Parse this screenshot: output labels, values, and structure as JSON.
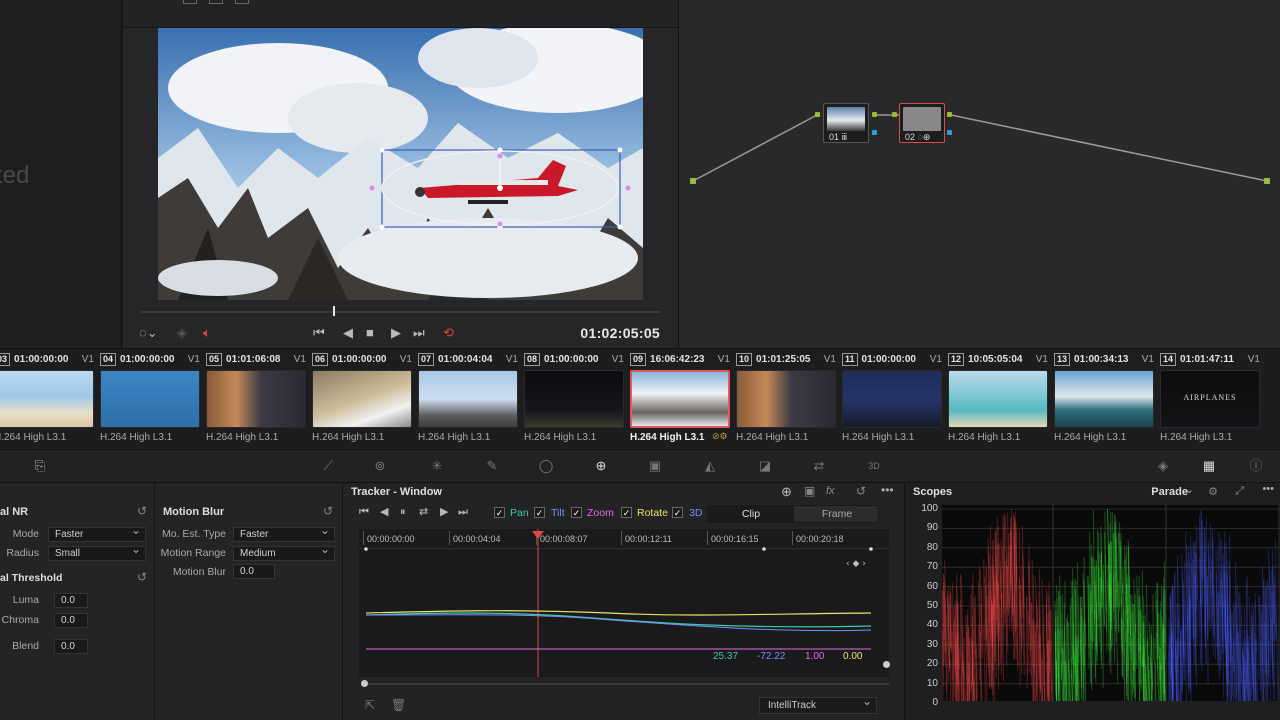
{
  "left_panel": {
    "ghost_text": "ted"
  },
  "viewer": {
    "timecode": "01:02:05:05",
    "playhead_fraction": 0.37
  },
  "nodes": [
    {
      "label": "01 ⅲ"
    },
    {
      "label": "02 ◌⊕"
    }
  ],
  "clips": [
    {
      "num": "03",
      "tc": "01:00:00:00",
      "track": "V1",
      "codec": "H.264 High L3.1",
      "thumb": "beach-people"
    },
    {
      "num": "04",
      "tc": "01:00:00:00",
      "track": "V1",
      "codec": "H.264 High L3.1",
      "thumb": "underwater-plane"
    },
    {
      "num": "05",
      "tc": "01:01:06:08",
      "track": "V1",
      "codec": "H.264 High L3.1",
      "thumb": "man-interview"
    },
    {
      "num": "06",
      "tc": "01:00:00:00",
      "track": "V1",
      "codec": "H.264 High L3.1",
      "thumb": "plane-tarmac"
    },
    {
      "num": "07",
      "tc": "01:00:04:04",
      "track": "V1",
      "codec": "H.264 High L3.1",
      "thumb": "plane-landing"
    },
    {
      "num": "08",
      "tc": "01:00:00:00",
      "track": "V1",
      "codec": "H.264 High L3.1",
      "thumb": "night-runway"
    },
    {
      "num": "09",
      "tc": "16:06:42:23",
      "track": "V1",
      "codec": "H.264 High L3.1",
      "thumb": "mountain-plane",
      "selected": true
    },
    {
      "num": "10",
      "tc": "01:01:25:05",
      "track": "V1",
      "codec": "H.264 High L3.1",
      "thumb": "man-interview"
    },
    {
      "num": "11",
      "tc": "01:00:00:00",
      "track": "V1",
      "codec": "H.264 High L3.1",
      "thumb": "night-sky"
    },
    {
      "num": "12",
      "tc": "10:05:05:04",
      "track": "V1",
      "codec": "H.264 High L3.1",
      "thumb": "ocean"
    },
    {
      "num": "13",
      "tc": "01:00:34:13",
      "track": "V1",
      "codec": "H.264 High L3.1",
      "thumb": "coast-aerial"
    },
    {
      "num": "14",
      "tc": "01:01:47:11",
      "track": "V1",
      "codec": "H.264 High L3.1",
      "thumb": "title-card",
      "thumb_text": "AIRPLANES"
    }
  ],
  "nr": {
    "title": "al NR",
    "mode_label": "Mode",
    "mode_value": "Faster",
    "radius_label": "Radius",
    "radius_value": "Small",
    "threshold_title": "al Threshold",
    "luma_label": "Luma",
    "luma_value": "0.0",
    "chroma_label": "Chroma",
    "chroma_value": "0.0",
    "blend_label": "Blend",
    "blend_value": "0.0"
  },
  "motion_blur": {
    "title": "Motion Blur",
    "est_label": "Mo. Est. Type",
    "est_value": "Faster",
    "range_label": "Motion Range",
    "range_value": "Medium",
    "blur_label": "Motion Blur",
    "blur_value": "0.0"
  },
  "tracker": {
    "title": "Tracker - Window",
    "pan": "Pan",
    "tilt": "Tilt",
    "zoom": "Zoom",
    "rotate": "Rotate",
    "three_d": "3D",
    "seg_clip": "Clip",
    "seg_frame": "Frame",
    "ruler": [
      "00:00:00:00",
      "00:00:04:04",
      "00:00:08:07",
      "00:00:12:11",
      "00:00:16:15",
      "00:00:20:18"
    ],
    "values": {
      "pan": "25.37",
      "tilt": "-72.22",
      "zoom": "1.00",
      "rotate": "0.00"
    },
    "mode": "IntelliTrack",
    "colors": {
      "pan": "#3ec9a7",
      "tilt": "#7a8dff",
      "zoom": "#e36be0",
      "rotate": "#e8e36a"
    }
  },
  "scopes": {
    "title": "Scopes",
    "mode": "Parade",
    "y_ticks": [
      "100",
      "90",
      "80",
      "70",
      "60",
      "50",
      "40",
      "30",
      "20",
      "10",
      "0"
    ]
  }
}
